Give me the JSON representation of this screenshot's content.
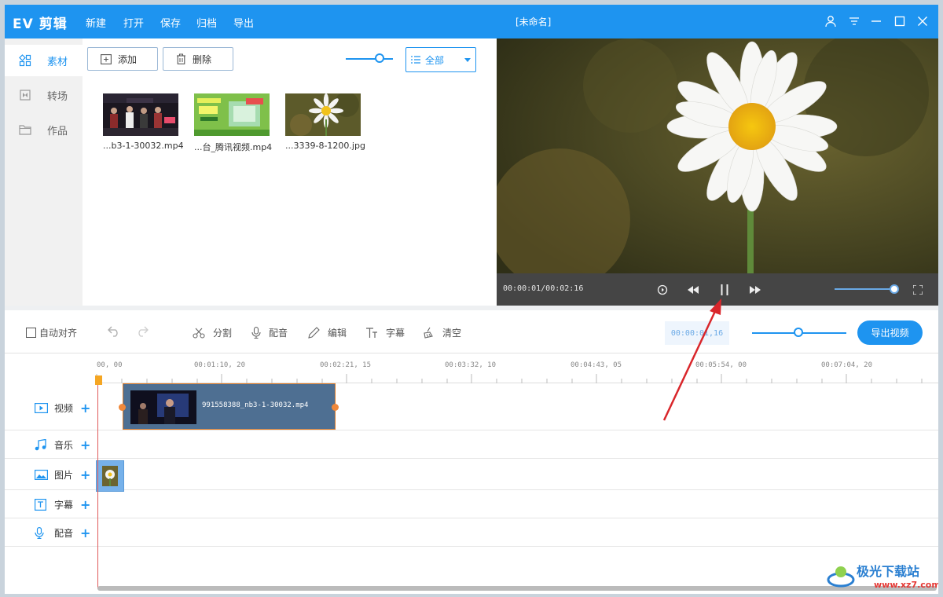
{
  "app": {
    "logo": "EV 剪辑",
    "menu": [
      "新建",
      "打开",
      "保存",
      "归档",
      "导出"
    ],
    "doc_title": "[未命名]"
  },
  "sidebar": {
    "items": [
      {
        "label": "素材",
        "icon": "grid-icon"
      },
      {
        "label": "转场",
        "icon": "transition-icon"
      },
      {
        "label": "作品",
        "icon": "folder-icon"
      }
    ]
  },
  "media": {
    "add_label": "添加",
    "delete_label": "删除",
    "filter_value": "全部",
    "thumb_size_level": 0.6,
    "files": [
      {
        "name": "...b3-1-30032.mp4"
      },
      {
        "name": "...台_腾讯视频.mp4"
      },
      {
        "name": "...3339-8-1200.jpg"
      }
    ]
  },
  "preview": {
    "time": "00:00:01/00:02:16",
    "volume_level": 0.95
  },
  "toolbar": {
    "auto_align": "自动对齐",
    "split": "分割",
    "voiceover": "配音",
    "edit": "编辑",
    "subtitle": "字幕",
    "clear": "清空",
    "current_time": "00:00:01,16",
    "zoom_level": 0.5,
    "export": "导出视频"
  },
  "ruler": {
    "ticks": [
      "00, 00",
      "00:01:10, 20",
      "00:02:21, 15",
      "00:03:32, 10",
      "00:04:43, 05",
      "00:05:54, 00",
      "00:07:04, 20"
    ]
  },
  "tracks": {
    "video": "视频",
    "music": "音乐",
    "image": "图片",
    "subtitle": "字幕",
    "voice": "配音",
    "video_clip": "991558388_nb3-1-30032.mp4"
  },
  "watermark": {
    "brand": "极光下载站",
    "url": "www.xz7.com"
  },
  "colors": {
    "accent": "#1e94f0",
    "clip": "#4e6f92",
    "playhead": "#e05a5a",
    "arrow": "#d9262b"
  }
}
